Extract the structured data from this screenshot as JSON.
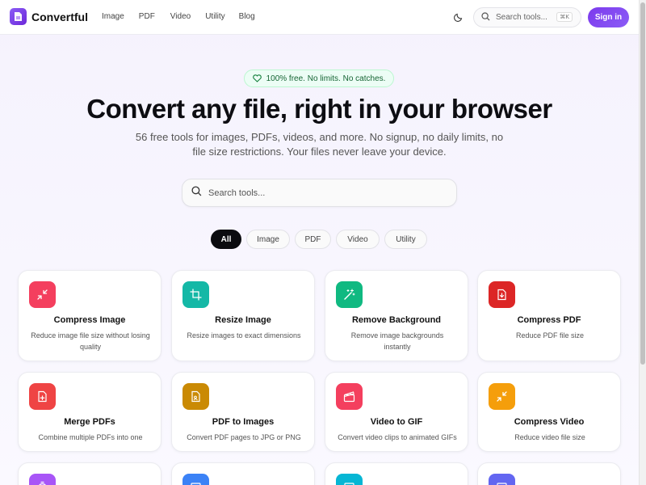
{
  "brand": {
    "name": "Convertful"
  },
  "nav": {
    "links": [
      "Image",
      "PDF",
      "Video",
      "Utility",
      "Blog"
    ],
    "search_placeholder": "Search tools...",
    "search_shortcut": "⌘K",
    "signin_label": "Sign in"
  },
  "hero": {
    "badge": "100% free. No limits. No catches.",
    "title": "Convert any file, right in your browser",
    "subtitle": "56 free tools for images, PDFs, videos, and more. No signup, no daily limits, no file size restrictions. Your files never leave your device.",
    "search_placeholder": "Search tools..."
  },
  "filters": [
    "All",
    "Image",
    "PDF",
    "Video",
    "Utility"
  ],
  "active_filter": "All",
  "tools": [
    {
      "title": "Compress Image",
      "desc": "Reduce image file size without losing quality",
      "icon": "compress-icon",
      "color": "#f43f5e"
    },
    {
      "title": "Resize Image",
      "desc": "Resize images to exact dimensions",
      "icon": "crop-icon",
      "color": "#14b8a6"
    },
    {
      "title": "Remove Background",
      "desc": "Remove image backgrounds instantly",
      "icon": "magic-wand-icon",
      "color": "#10b981"
    },
    {
      "title": "Compress PDF",
      "desc": "Reduce PDF file size",
      "icon": "file-download-icon",
      "color": "#dc2626"
    },
    {
      "title": "Merge PDFs",
      "desc": "Combine multiple PDFs into one",
      "icon": "file-plus-icon",
      "color": "#ef4444"
    },
    {
      "title": "PDF to Images",
      "desc": "Convert PDF pages to JPG or PNG",
      "icon": "file-image-icon",
      "color": "#ca8a04"
    },
    {
      "title": "Video to GIF",
      "desc": "Convert video clips to animated GIFs",
      "icon": "clapperboard-icon",
      "color": "#f43f5e"
    },
    {
      "title": "Compress Video",
      "desc": "Reduce video file size",
      "icon": "compress-icon",
      "color": "#f59e0b"
    },
    {
      "title": "",
      "desc": "",
      "icon": "timer-icon",
      "color": "#a855f7"
    },
    {
      "title": "",
      "desc": "",
      "icon": "image-icon",
      "color": "#3b82f6"
    },
    {
      "title": "",
      "desc": "",
      "icon": "image-icon",
      "color": "#06b6d4"
    },
    {
      "title": "",
      "desc": "",
      "icon": "image-icon",
      "color": "#6366f1"
    }
  ]
}
